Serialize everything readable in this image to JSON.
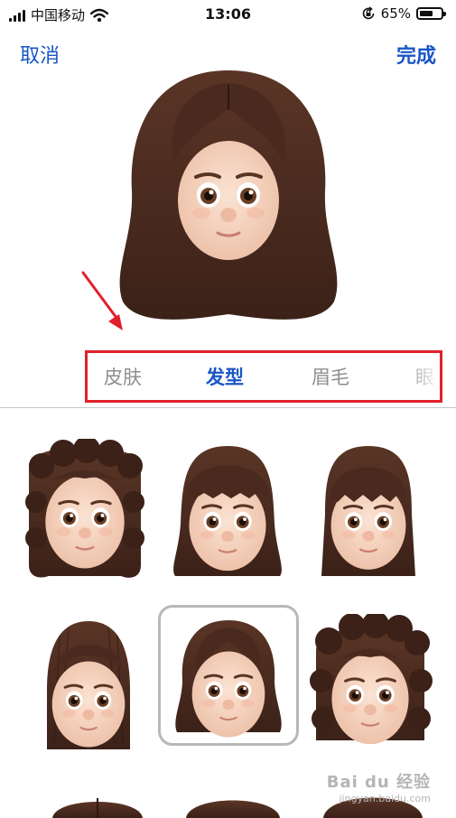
{
  "status_bar": {
    "carrier": "中国移动",
    "time": "13:06",
    "battery_percent": "65%",
    "battery_level": 0.65,
    "icons": [
      "signal-icon",
      "wifi-icon",
      "orientation-lock-icon",
      "battery-icon"
    ]
  },
  "nav": {
    "cancel_label": "取消",
    "done_label": "完成"
  },
  "tabs": [
    {
      "label": "皮肤",
      "active": false
    },
    {
      "label": "发型",
      "active": true
    },
    {
      "label": "眉毛",
      "active": false
    },
    {
      "label": "眼",
      "active": false
    }
  ],
  "hairstyles": {
    "options": [
      {
        "name": "curly-long",
        "selected": false
      },
      {
        "name": "wavy-bangs",
        "selected": false
      },
      {
        "name": "straight-bangs",
        "selected": false
      },
      {
        "name": "slicked-long",
        "selected": false
      },
      {
        "name": "middle-part-wavy",
        "selected": true
      },
      {
        "name": "curly-medium",
        "selected": false
      }
    ]
  },
  "colors": {
    "accent": "#1a56c5",
    "highlight_box": "#e0202a",
    "hair": "#4a2a1e",
    "skin": "#f5d2bd"
  },
  "watermark": {
    "logo": "Bai du 经验",
    "url": "jingyan.baidu.com"
  }
}
